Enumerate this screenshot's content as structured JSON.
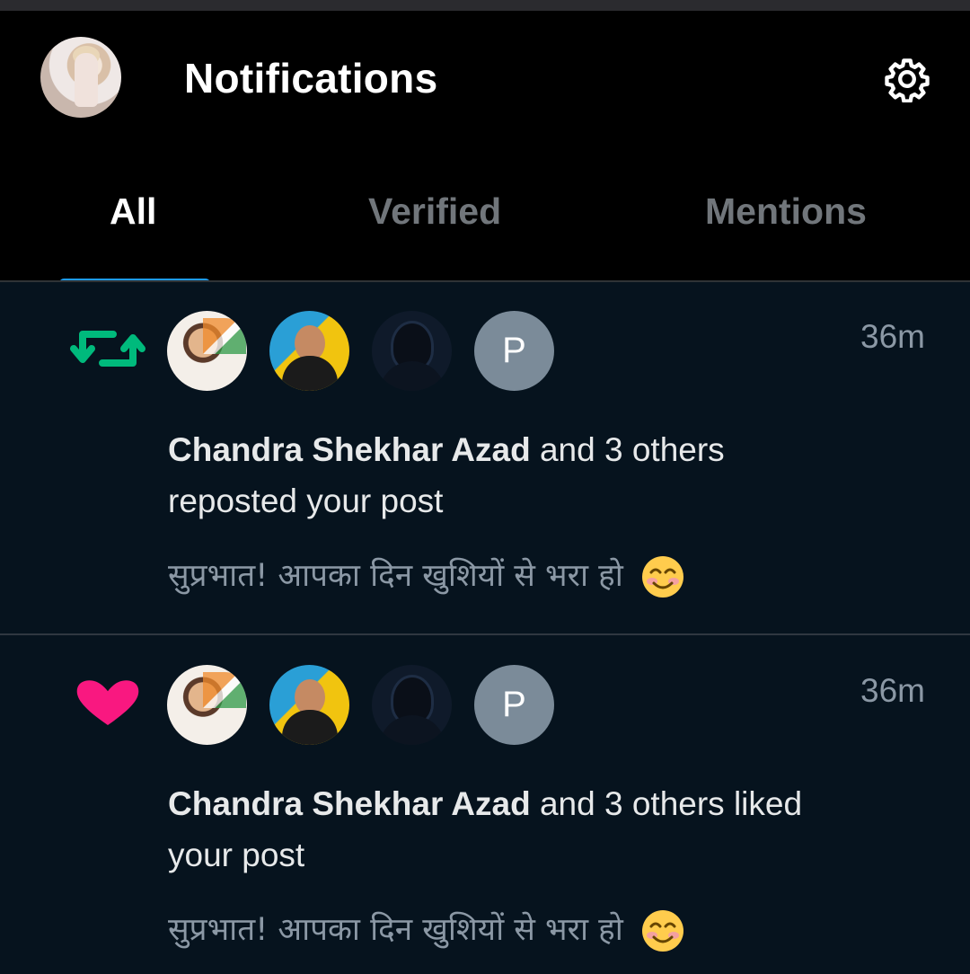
{
  "header": {
    "title": "Notifications"
  },
  "tabs": [
    {
      "label": "All",
      "active": true
    },
    {
      "label": "Verified",
      "active": false
    },
    {
      "label": "Mentions",
      "active": false
    }
  ],
  "notifications": [
    {
      "type": "repost",
      "type_icon": "repost-icon",
      "icon_color": "#00ba7c",
      "time": "36m",
      "actor": "Chandra Shekhar Azad",
      "rest": " and 3 others reposted your post",
      "post_text": "सुप्रभात! आपका दिन खुशियों से भरा हो",
      "avatars": [
        "avatar-chandra",
        "avatar-man-glasses",
        "avatar-hooded",
        "P"
      ]
    },
    {
      "type": "like",
      "type_icon": "heart-icon",
      "icon_color": "#f91880",
      "time": "36m",
      "actor": "Chandra Shekhar Azad",
      "rest": " and 3 others liked your post",
      "post_text": "सुप्रभात! आपका दिन खुशियों से भरा हो",
      "avatars": [
        "avatar-chandra",
        "avatar-man-glasses",
        "avatar-hooded",
        "P"
      ]
    }
  ],
  "colors": {
    "accent": "#1d9bf0",
    "background": "#000000",
    "feed_background": "#06131e"
  }
}
